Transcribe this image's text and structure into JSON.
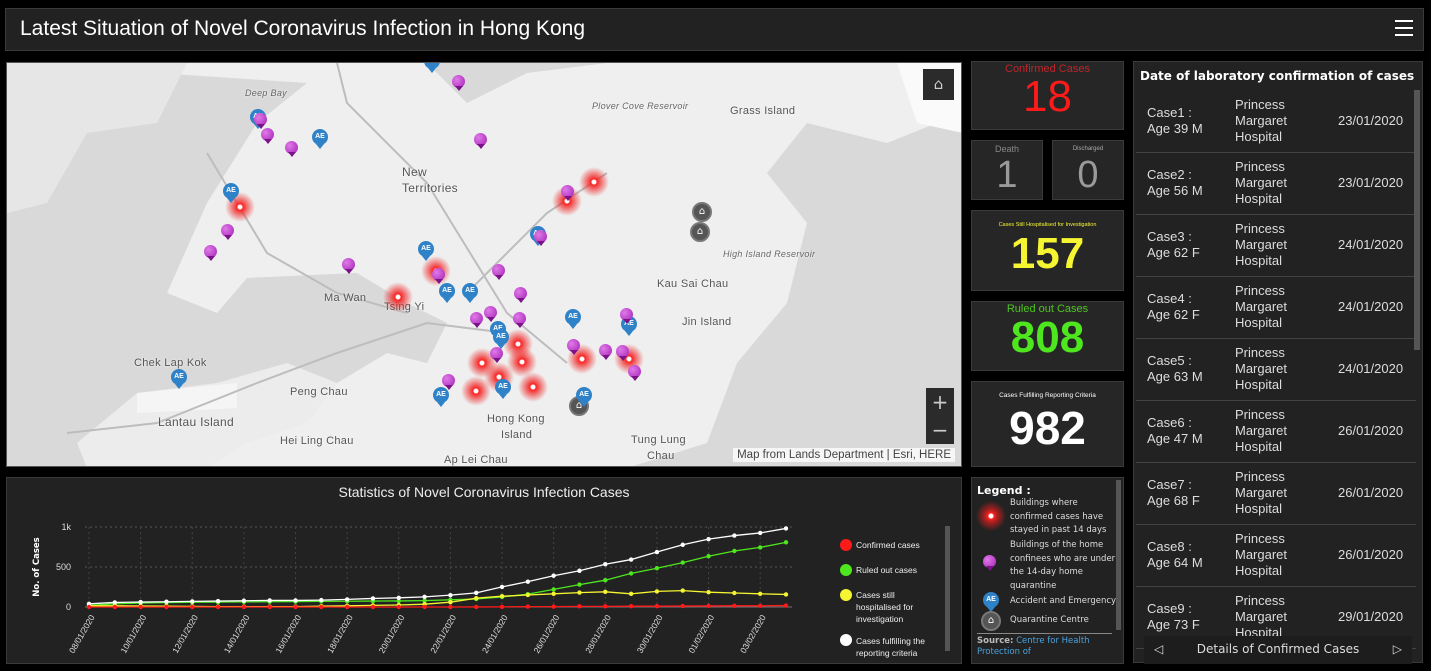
{
  "header": {
    "title": "Latest Situation of Novel Coronavirus Infection in Hong Kong",
    "menu_icon": "hamburger-icon"
  },
  "map": {
    "labels": {
      "deep_bay": "Deep Bay",
      "plover": "Plover Cove Reservoir",
      "grass": "Grass Island",
      "nt1": "New",
      "nt2": "Territories",
      "high_island": "High Island Reservoir",
      "kau_sai_chau": "Kau Sai Chau",
      "ma_wan": "Ma Wan",
      "tsing_yi": "Tsing Yi",
      "jin": "Jin Island",
      "chek_lap_kok": "Chek Lap Kok",
      "peng_chau": "Peng Chau",
      "lantau": "Lantau Island",
      "hk1": "Hong Kong",
      "hk2": "Island",
      "hei_ling_chau": "Hei Ling Chau",
      "tung1": "Tung Lung",
      "tung2": "Chau",
      "ap_lei_chau": "Ap Lei Chau"
    },
    "ae_text": "AE",
    "attribution": "Map from Lands Department | Esri, HERE",
    "zoom_in": "+",
    "zoom_out": "−",
    "home_icon": "home-icon"
  },
  "stats": {
    "confirmed": {
      "label": "Confirmed Cases",
      "value": "18",
      "color": "#ff1a1a"
    },
    "death": {
      "label": "Death",
      "value": "1",
      "color": "#9a9a9a"
    },
    "discharged": {
      "label": "Discharged",
      "value": "0",
      "color": "#9a9a9a"
    },
    "hospitalised": {
      "label": "Cases Still Hospitalised for Investigation",
      "value": "157",
      "color": "#f5f532"
    },
    "ruled_out": {
      "label": "Ruled out Cases",
      "value": "808",
      "color": "#4ee61e"
    },
    "criteria": {
      "label": "Cases Fulfilling Reporting Criteria",
      "value": "982",
      "color": "#ffffff"
    }
  },
  "cases": {
    "title": "Date of laboratory confirmation of cases",
    "rows": [
      {
        "case": "Case1 :",
        "age": "Age 39 M",
        "hospital": [
          "Princess",
          "Margaret",
          "Hospital"
        ],
        "date": "23/01/2020"
      },
      {
        "case": "Case2 :",
        "age": "Age 56 M",
        "hospital": [
          "Princess",
          "Margaret",
          "Hospital"
        ],
        "date": "23/01/2020"
      },
      {
        "case": "Case3 :",
        "age": "Age 62 F",
        "hospital": [
          "Princess",
          "Margaret",
          "Hospital"
        ],
        "date": "24/01/2020"
      },
      {
        "case": "Case4 :",
        "age": "Age 62 F",
        "hospital": [
          "Princess",
          "Margaret",
          "Hospital"
        ],
        "date": "24/01/2020"
      },
      {
        "case": "Case5 :",
        "age": "Age 63 M",
        "hospital": [
          "Princess",
          "Margaret",
          "Hospital"
        ],
        "date": "24/01/2020"
      },
      {
        "case": "Case6 :",
        "age": "Age 47 M",
        "hospital": [
          "Princess",
          "Margaret",
          "Hospital"
        ],
        "date": "26/01/2020"
      },
      {
        "case": "Case7 :",
        "age": "Age 68 F",
        "hospital": [
          "Princess",
          "Margaret",
          "Hospital"
        ],
        "date": "26/01/2020"
      },
      {
        "case": "Case8 :",
        "age": "Age 64 M",
        "hospital": [
          "Princess",
          "Margaret",
          "Hospital"
        ],
        "date": "26/01/2020"
      },
      {
        "case": "Case9 :",
        "age": "Age 73 F",
        "hospital": [
          "Princess",
          "Margaret",
          "Hospital"
        ],
        "date": "29/01/2020"
      }
    ],
    "footer": "Details of Confirmed Cases",
    "prev": "◁",
    "next": "▷"
  },
  "legend": {
    "title": "Legend :",
    "items": [
      {
        "icon": "red-glow-icon",
        "label": "Buildings where confirmed cases have stayed in past 14 days"
      },
      {
        "icon": "purple-pin-icon",
        "label": "Buildings of the home confinees who are under the 14-day home quarantine"
      },
      {
        "icon": "ae-marker-icon",
        "label": "Accident and Emergency"
      },
      {
        "icon": "quarantine-centre-icon",
        "label": "Quarantine Centre"
      }
    ],
    "source_label": "Source:",
    "source_link": "Centre for Health Protection of"
  },
  "chart_data": {
    "type": "line",
    "title": "Statistics of Novel Coronavirus Infection Cases",
    "xlabel": "",
    "ylabel": "No. of Cases",
    "ylim": [
      0,
      1000
    ],
    "yticks": [
      0,
      500,
      1000
    ],
    "ytick_labels": [
      "0",
      "500",
      "1k"
    ],
    "grid": true,
    "legend": "right",
    "x": [
      "08/01/2020",
      "09/01/2020",
      "10/01/2020",
      "11/01/2020",
      "12/01/2020",
      "13/01/2020",
      "14/01/2020",
      "15/01/2020",
      "16/01/2020",
      "17/01/2020",
      "18/01/2020",
      "19/01/2020",
      "20/01/2020",
      "21/01/2020",
      "22/01/2020",
      "23/01/2020",
      "24/01/2020",
      "25/01/2020",
      "26/01/2020",
      "27/01/2020",
      "28/01/2020",
      "29/01/2020",
      "30/01/2020",
      "31/01/2020",
      "01/02/2020",
      "02/02/2020",
      "03/02/2020",
      "04/02/2020"
    ],
    "xtick_labels": [
      "08/01/2020",
      "10/01/2020",
      "12/01/2020",
      "14/01/2020",
      "16/01/2020",
      "18/01/2020",
      "20/01/2020",
      "22/01/2020",
      "24/01/2020",
      "26/01/2020",
      "28/01/2020",
      "30/01/2020",
      "01/02/2020",
      "03/02/2020"
    ],
    "series": [
      {
        "name": "Confirmed cases",
        "color": "#ff1a1a",
        "values": [
          0,
          0,
          0,
          0,
          0,
          0,
          0,
          0,
          0,
          0,
          0,
          0,
          0,
          0,
          0,
          1,
          2,
          5,
          5,
          8,
          8,
          10,
          10,
          12,
          13,
          15,
          15,
          18
        ]
      },
      {
        "name": "Ruled out cases",
        "color": "#4ee61e",
        "values": [
          20,
          40,
          50,
          55,
          60,
          62,
          64,
          66,
          68,
          70,
          72,
          74,
          76,
          80,
          90,
          100,
          125,
          160,
          220,
          280,
          335,
          420,
          485,
          555,
          635,
          700,
          745,
          808
        ]
      },
      {
        "name": "Cases still hospitalised for investigation",
        "color": "#f5f532",
        "values": [
          15,
          15,
          12,
          10,
          8,
          5,
          5,
          5,
          5,
          10,
          15,
          20,
          25,
          35,
          60,
          110,
          135,
          150,
          165,
          180,
          190,
          165,
          195,
          205,
          185,
          175,
          165,
          157
        ]
      },
      {
        "name": "Cases fulfilling the reporting criteria",
        "color": "#ffffff",
        "values": [
          40,
          57,
          62,
          66,
          70,
          74,
          78,
          82,
          82,
          86,
          95,
          107,
          115,
          127,
          148,
          177,
          251,
          317,
          391,
          453,
          535,
          593,
          687,
          778,
          848,
          893,
          926,
          982
        ]
      }
    ]
  }
}
